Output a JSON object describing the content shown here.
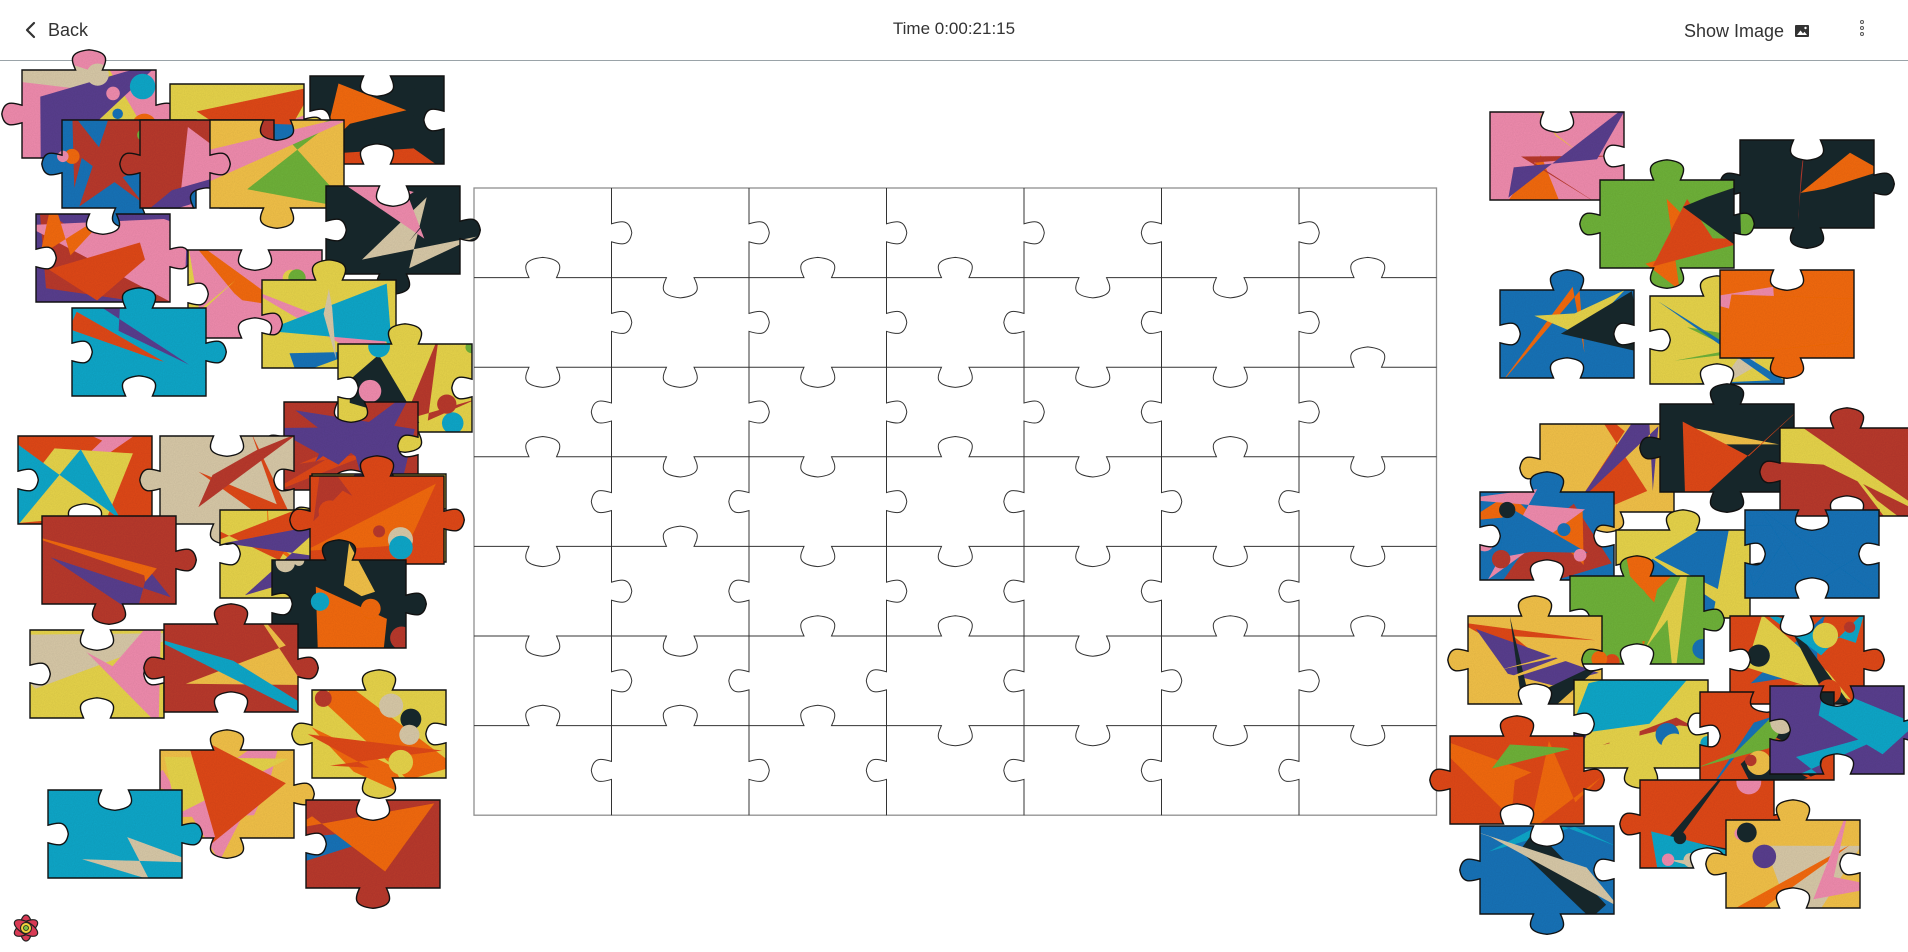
{
  "header": {
    "back_label": "Back",
    "timer_text": "Time 0:00:21:15",
    "show_image_label": "Show Image"
  },
  "icons": {
    "back": "chevron-left-icon",
    "show_image": "image-icon",
    "menu": "kebab-menu-icon",
    "logo": "flower-logo-icon"
  },
  "puzzle": {
    "board_rows": 7,
    "board_cols": 7,
    "placed_pieces": 0
  },
  "palette": [
    "#f36b12",
    "#1a73b8",
    "#f08cae",
    "#6fb23a",
    "#f2c14a",
    "#5a3f8f",
    "#19a7c9",
    "#e04a1f",
    "#d8c9a8",
    "#1f2a2e",
    "#e7d44c",
    "#b93b2f"
  ]
}
